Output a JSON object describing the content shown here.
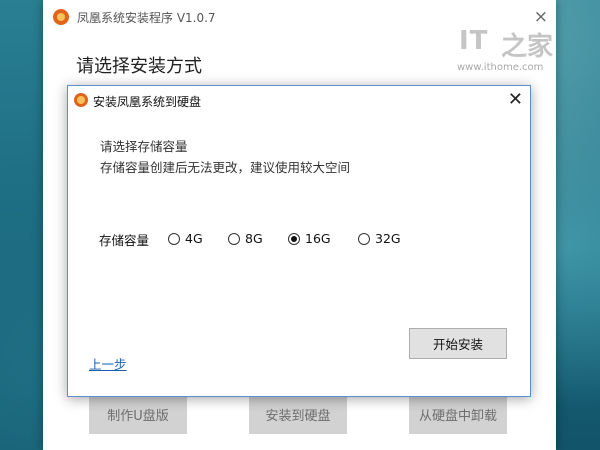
{
  "main_window": {
    "title": "凤凰系统安装程序 V1.0.7",
    "close_glyph": "×",
    "heading": "请选择安装方式",
    "buttons": {
      "make_usb": "制作U盘版",
      "install_hdd": "安装到硬盘",
      "uninstall_hdd": "从硬盘中卸载"
    }
  },
  "watermark": {
    "brand": "IT",
    "brand_cn": "之家",
    "url": "www.ithome.com"
  },
  "dialog": {
    "title": "安装凤凰系统到硬盘",
    "close_glyph": "✕",
    "prompt_line1": "请选择存储容量",
    "prompt_line2": "存储容量创建后无法更改，建议使用较大空间",
    "capacity_label": "存储容量",
    "options": [
      {
        "label": "4G",
        "selected": false
      },
      {
        "label": "8G",
        "selected": false
      },
      {
        "label": "16G",
        "selected": true
      },
      {
        "label": "32G",
        "selected": false
      }
    ],
    "back_link": "上一步",
    "start_button": "开始安装"
  },
  "colors": {
    "app_icon": "#e0641c",
    "dialog_border": "#5b8fd0",
    "link": "#1a5fb4"
  }
}
